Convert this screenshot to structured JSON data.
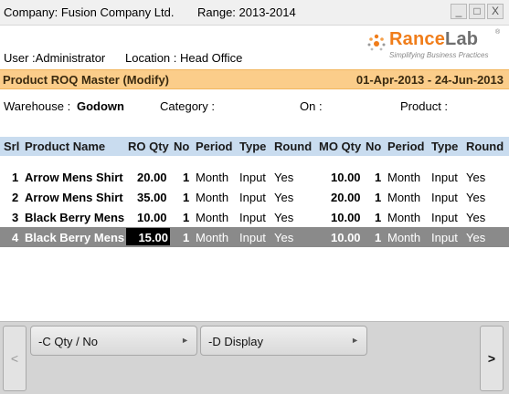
{
  "header": {
    "company": "Company: Fusion Company Ltd.",
    "range": "Range: 2013-2014",
    "user": "User :Administrator",
    "location": "Location : Head Office",
    "window_buttons": [
      "_",
      "□",
      "X"
    ]
  },
  "logo": {
    "brand_rance": "Rance",
    "brand_lab": "Lab",
    "registered": "®",
    "tagline": "Simplifying Business Practices"
  },
  "titlebar": {
    "title": "Product ROQ Master (Modify)",
    "dates": "01-Apr-2013 - 24-Jun-2013"
  },
  "filters": {
    "warehouse_label": "Warehouse :",
    "warehouse_value": "Godown",
    "category_label": "Category :",
    "on_label": "On :",
    "product_label": "Product :"
  },
  "table": {
    "headers": {
      "srl": "Srl",
      "product": "Product Name",
      "ro_qty": "RO Qty",
      "ro_no": "No",
      "ro_period": "Period",
      "ro_type": "Type",
      "ro_round": "Round",
      "mo_qty": "MO Qty",
      "mo_no": "No",
      "mo_period": "Period",
      "mo_type": "Type",
      "mo_round": "Round"
    },
    "rows": [
      {
        "srl": "1",
        "product": "Arrow Mens Shirt",
        "ro_qty": "20.00",
        "ro_no": "1",
        "ro_period": "Month",
        "ro_type": "Input",
        "ro_round": "Yes",
        "mo_qty": "10.00",
        "mo_no": "1",
        "mo_period": "Month",
        "mo_type": "Input",
        "mo_round": "Yes"
      },
      {
        "srl": "2",
        "product": "Arrow Mens Shirt",
        "ro_qty": "35.00",
        "ro_no": "1",
        "ro_period": "Month",
        "ro_type": "Input",
        "ro_round": "Yes",
        "mo_qty": "20.00",
        "mo_no": "1",
        "mo_period": "Month",
        "mo_type": "Input",
        "mo_round": "Yes"
      },
      {
        "srl": "3",
        "product": "Black Berry Mens",
        "ro_qty": "10.00",
        "ro_no": "1",
        "ro_period": "Month",
        "ro_type": "Input",
        "ro_round": "Yes",
        "mo_qty": "10.00",
        "mo_no": "1",
        "mo_period": "Month",
        "mo_type": "Input",
        "mo_round": "Yes"
      },
      {
        "srl": "4",
        "product": "Black Berry Mens",
        "ro_qty": "15.00",
        "ro_no": "1",
        "ro_period": "Month",
        "ro_type": "Input",
        "ro_round": "Yes",
        "mo_qty": "10.00",
        "mo_no": "1",
        "mo_period": "Month",
        "mo_type": "Input",
        "mo_round": "Yes"
      }
    ]
  },
  "footer": {
    "prev_label": "<",
    "next_label": ">",
    "buttons": [
      {
        "label": "-C Qty / No",
        "arrow": "►"
      },
      {
        "label": "-D Display",
        "arrow": "►"
      }
    ]
  },
  "colors": {
    "title_bar_bg": "#fbcd8a",
    "header_row_bg": "#c9dcef",
    "selected_row_bg": "#8a8a8a",
    "brand_orange": "#f07d1a"
  }
}
